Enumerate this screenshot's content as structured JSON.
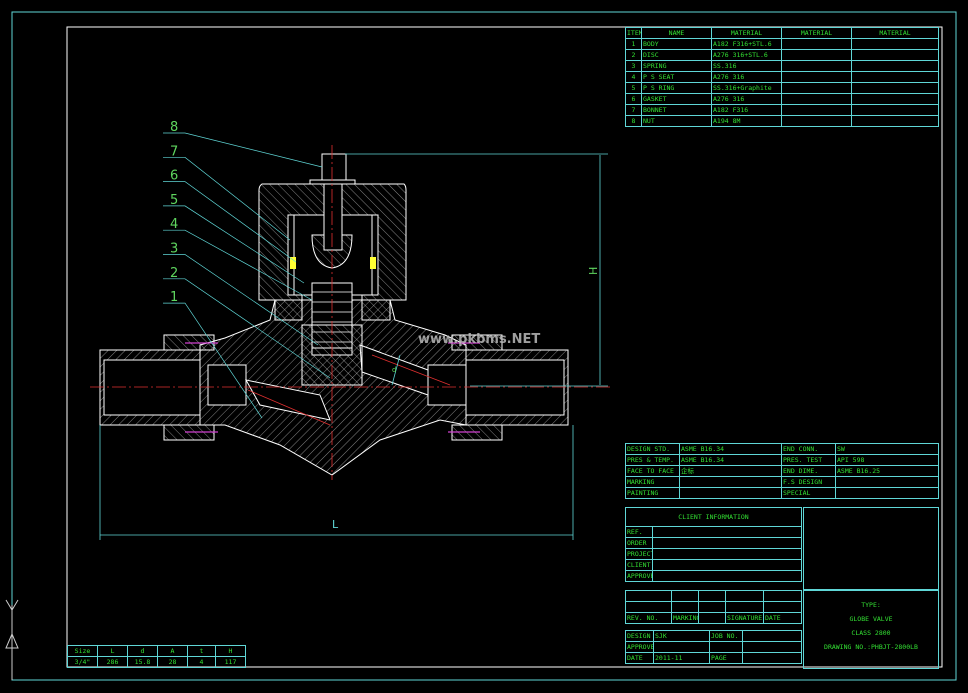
{
  "parts_table": {
    "header": [
      "ITEM",
      "NAME",
      "MATERIAL",
      "MATERIAL",
      "MATERIAL"
    ],
    "rows": [
      [
        "1",
        "BODY",
        "A182 F316+STL.6",
        "",
        ""
      ],
      [
        "2",
        "DISC",
        "A276 316+STL.6",
        "",
        ""
      ],
      [
        "3",
        "SPRING",
        "SS.316",
        "",
        ""
      ],
      [
        "4",
        "P S SEAT",
        "A276 316",
        "",
        ""
      ],
      [
        "5",
        "P S RING",
        "SS.316+Graphite",
        "",
        ""
      ],
      [
        "6",
        "GASKET",
        "A276 316",
        "",
        ""
      ],
      [
        "7",
        "BONNET",
        "A182 F316",
        "",
        ""
      ],
      [
        "8",
        "NUT",
        "A194 8M",
        "",
        ""
      ]
    ]
  },
  "spec_table": {
    "rows": [
      [
        "DESIGN STD.",
        "ASME B16.34",
        "END CONN.",
        "SW"
      ],
      [
        "PRES & TEMP.",
        "ASME B16.34",
        "PRES. TEST",
        "API 598"
      ],
      [
        "FACE TO FACE",
        "企标",
        "END DIME.",
        "ASME B16.25"
      ],
      [
        "MARKING",
        "",
        "F.S DESIGN",
        ""
      ],
      [
        "PAINTING",
        "",
        "SPECIAL",
        ""
      ]
    ]
  },
  "client_info": {
    "title": "CLIENT INFORMATION",
    "rows": [
      [
        "REF.",
        ""
      ],
      [
        "ORDER",
        ""
      ],
      [
        "PROJECT",
        ""
      ],
      [
        "CLIENT",
        ""
      ],
      [
        "APPROVE",
        ""
      ]
    ]
  },
  "revision_table": {
    "rows": [
      [
        "",
        "",
        "",
        "",
        ""
      ],
      [
        "",
        "",
        "",
        "",
        ""
      ],
      [
        "REV. NO.",
        "MARKING",
        "",
        "SIGNATURE",
        "DATE"
      ]
    ]
  },
  "design_table": {
    "rows": [
      [
        "DESIGN",
        "SJK",
        "JOB NO.",
        ""
      ],
      [
        "APPROVE",
        "",
        "",
        ""
      ],
      [
        "DATE",
        "2011-11",
        "PAGE",
        ""
      ]
    ]
  },
  "title_block": {
    "type_label": "TYPE:",
    "name": "GLOBE VALVE",
    "class": "CLASS 2800",
    "drawing_no": "DRAWING NO.:PHBJT-2800LB"
  },
  "size_table": {
    "header": [
      "Size",
      "L",
      "d",
      "A",
      "t",
      "H"
    ],
    "rows": [
      [
        "3/4\"",
        "286",
        "15.8",
        "28",
        "4",
        "117"
      ]
    ]
  },
  "drawing": {
    "callouts": [
      "8",
      "7",
      "6",
      "5",
      "4",
      "3",
      "2",
      "1"
    ],
    "dim_length": "L",
    "dim_height": "H",
    "dim_d": "d",
    "watermark": "www.pkbms.NET"
  },
  "colors": {
    "line": "#ffffff",
    "frame": "#5fd6d6",
    "text": "#33e033",
    "centerline": "#e03030",
    "gasket": "#ffff33",
    "seal": "#d040d0"
  }
}
